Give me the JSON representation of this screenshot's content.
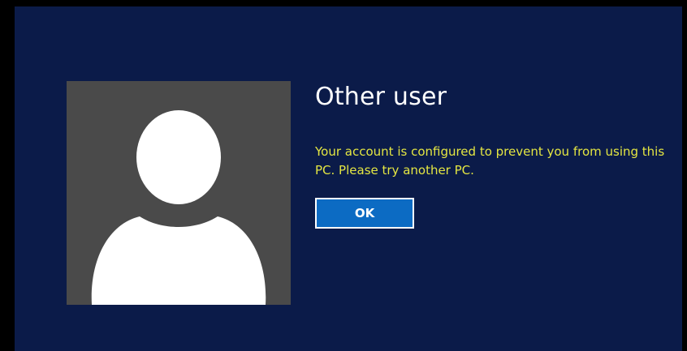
{
  "lock_screen": {
    "user_name": "Other user",
    "message": "Your account is configured to prevent you from using this PC. Please try another PC.",
    "ok_label": "OK",
    "avatar_icon": "default-user-avatar-icon"
  },
  "colors": {
    "outer_background": "#000000",
    "panel_background": "#0b1b49",
    "avatar_background": "#4a4a4a",
    "message_text": "#e4e642",
    "button_background": "#0c6bc3",
    "button_border": "#ffffff"
  }
}
